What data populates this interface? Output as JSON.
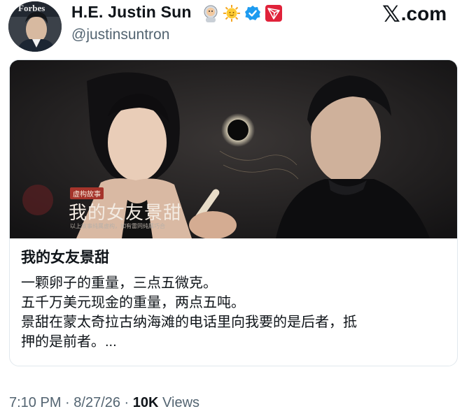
{
  "author": {
    "avatar_badge": "Forbes",
    "name": "H.E. Justin Sun",
    "handle": "@justinsuntron",
    "badges": [
      "astronaut-emoji",
      "sun-emoji",
      "verified-badge-icon",
      "tron-logo-icon"
    ]
  },
  "brand": {
    "logo_mark": "𝕏",
    "logo_text": ".com"
  },
  "card": {
    "cover": {
      "badge": "虚构故事",
      "title": "我的女友景甜",
      "subtitle": "以上故事纯属虚构，如有雷同纯属巧合"
    },
    "title": "我的女友景甜",
    "lines": [
      "一颗卵子的重量，三点五微克。",
      "五千万美元现金的重量，两点五吨。",
      "景甜在蒙太奇拉古纳海滩的电话里向我要的是后者，抵",
      "押的是前者。..."
    ]
  },
  "meta": {
    "time": "7:10 PM",
    "sep1": " · ",
    "date": "8/27/26",
    "sep2": " · ",
    "views_count": "10K",
    "views_label": " Views"
  },
  "colors": {
    "verified": "#1d9bf0",
    "tron": "#e0223a",
    "muted_text": "#536471"
  }
}
